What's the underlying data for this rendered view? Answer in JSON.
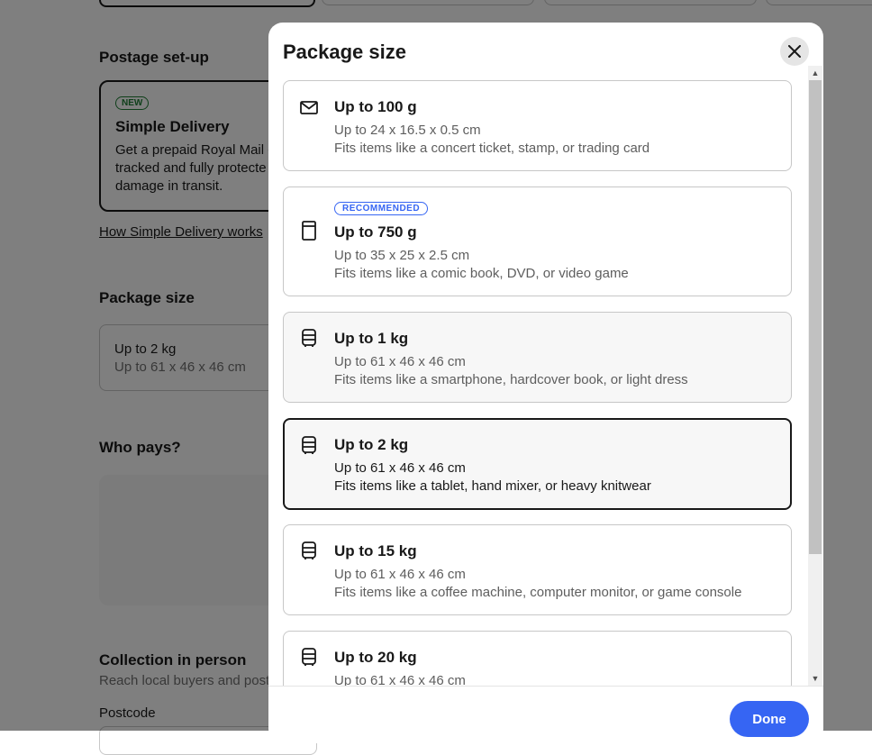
{
  "background": {
    "postage_heading": "Postage set-up",
    "simple_delivery": {
      "badge": "NEW",
      "title": "Simple Delivery",
      "desc": "Get a prepaid Royal Mail c tracked and fully protecte damage in transit."
    },
    "how_link": "How Simple Delivery works",
    "package_heading": "Package size",
    "package_value": "Up to 2 kg",
    "package_dims": "Up to 61 x 46 x 46 cm",
    "who_pays_heading": "Who pays?",
    "collection_heading": "Collection in person",
    "collection_desc": "Reach local buyers and post",
    "postcode_label": "Postcode"
  },
  "modal": {
    "title": "Package size",
    "done_label": "Done",
    "recommended_badge": "RECOMMENDED",
    "options": [
      {
        "icon": "envelope-icon",
        "title": "Up to 100 g",
        "dims": "Up to 24 x 16.5 x 0.5 cm",
        "fits": "Fits items like a concert ticket, stamp, or trading card"
      },
      {
        "icon": "large-envelope-icon",
        "title": "Up to 750 g",
        "dims": "Up to 35 x 25 x 2.5 cm",
        "fits": "Fits items like a comic book, DVD, or video game",
        "recommended": true
      },
      {
        "icon": "parcel-icon",
        "title": "Up to 1 kg",
        "dims": "Up to 61 x 46 x 46 cm",
        "fits": "Fits items like a smartphone, hardcover book, or light dress"
      },
      {
        "icon": "parcel-icon",
        "title": "Up to 2 kg",
        "dims": "Up to 61 x 46 x 46 cm",
        "fits": "Fits items like a tablet, hand mixer, or heavy knitwear",
        "selected": true
      },
      {
        "icon": "parcel-icon",
        "title": "Up to 15 kg",
        "dims": "Up to 61 x 46 x 46 cm",
        "fits": "Fits items like a coffee machine, computer monitor, or game console"
      },
      {
        "icon": "parcel-icon",
        "title": "Up to 20 kg",
        "dims": "Up to 61 x 46 x 46 cm",
        "fits": ""
      }
    ]
  },
  "colors": {
    "accent": "#3665f3",
    "new_badge": "#1e7e34",
    "overlay": "rgba(0,0,0,0.5)"
  }
}
